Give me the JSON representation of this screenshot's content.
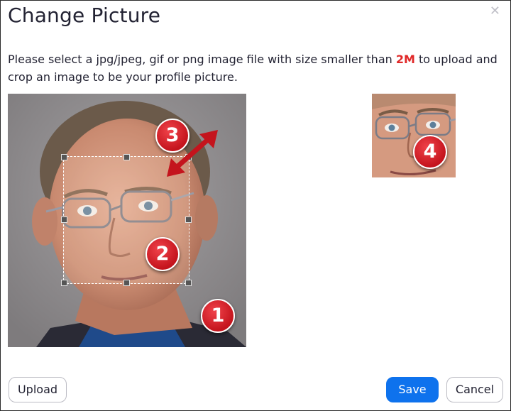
{
  "dialog": {
    "title": "Change Picture",
    "close_icon": "close-icon"
  },
  "instructions": {
    "before": "Please select a jpg/jpeg, gif or png image file with size smaller than ",
    "highlight": "2M",
    "after": " to upload and crop an image to be your profile picture."
  },
  "callouts": [
    "1",
    "2",
    "3",
    "4"
  ],
  "buttons": {
    "upload": "Upload",
    "save": "Save",
    "cancel": "Cancel"
  },
  "colors": {
    "primary": "#0e72ed",
    "highlight": "#e02828",
    "callout": "#d9202a"
  }
}
